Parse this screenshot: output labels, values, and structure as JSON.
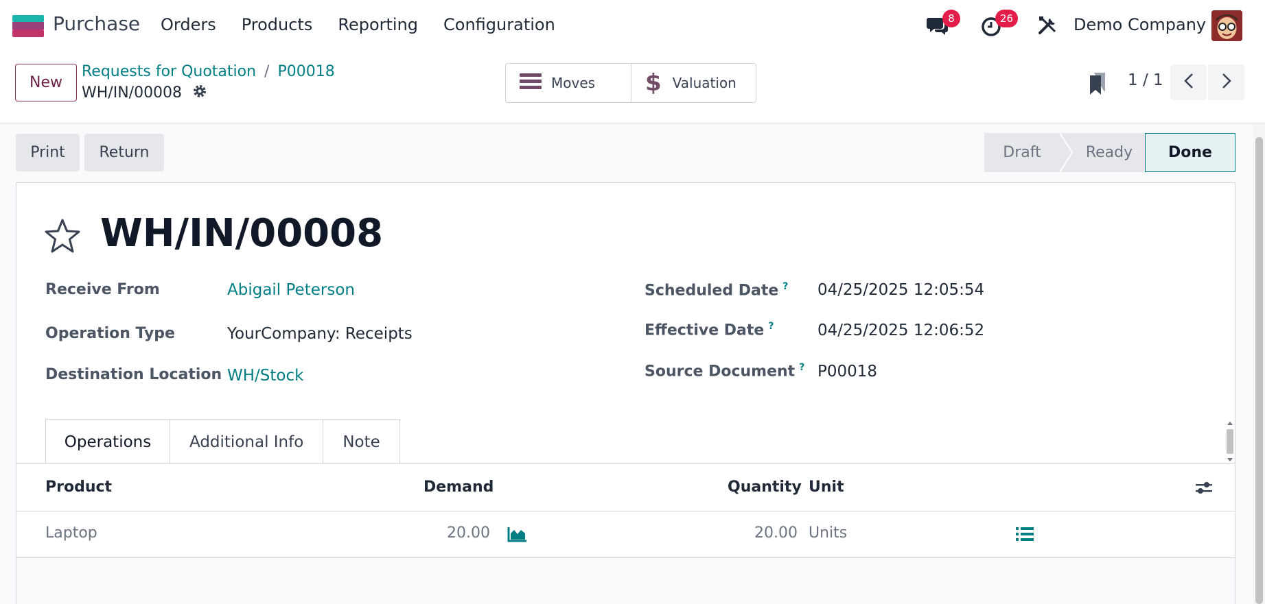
{
  "app": {
    "name": "Purchase",
    "menu": [
      "Orders",
      "Products",
      "Reporting",
      "Configuration"
    ],
    "messages_count": "8",
    "activities_count": "26",
    "company": "Demo Company"
  },
  "control": {
    "new_label": "New",
    "breadcrumbs": [
      "Requests for Quotation",
      "P00018"
    ],
    "current": "WH/IN/00008",
    "smart_buttons": {
      "moves": "Moves",
      "valuation": "Valuation"
    },
    "pager": "1 / 1"
  },
  "actions": {
    "print": "Print",
    "return": "Return"
  },
  "status": {
    "stages": [
      "Draft",
      "Ready",
      "Done"
    ],
    "current": "Done"
  },
  "record": {
    "title": "WH/IN/00008",
    "receive_from_label": "Receive From",
    "receive_from": "Abigail Peterson",
    "operation_type_label": "Operation Type",
    "operation_type": "YourCompany: Receipts",
    "destination_label": "Destination Location",
    "destination": "WH/Stock",
    "scheduled_date_label": "Scheduled Date",
    "scheduled_date": "04/25/2025 12:05:54",
    "effective_date_label": "Effective Date",
    "effective_date": "04/25/2025 12:06:52",
    "source_document_label": "Source Document",
    "source_document": "P00018",
    "help_mark": "?"
  },
  "tabs": [
    "Operations",
    "Additional Info",
    "Note"
  ],
  "table": {
    "headers": {
      "product": "Product",
      "demand": "Demand",
      "quantity": "Quantity",
      "unit": "Unit"
    },
    "rows": [
      {
        "product": "Laptop",
        "demand": "20.00",
        "quantity": "20.00",
        "unit": "Units"
      }
    ]
  },
  "colors": {
    "accent": "#017e84",
    "brand": "#714b67",
    "badge": "#e11d48"
  }
}
